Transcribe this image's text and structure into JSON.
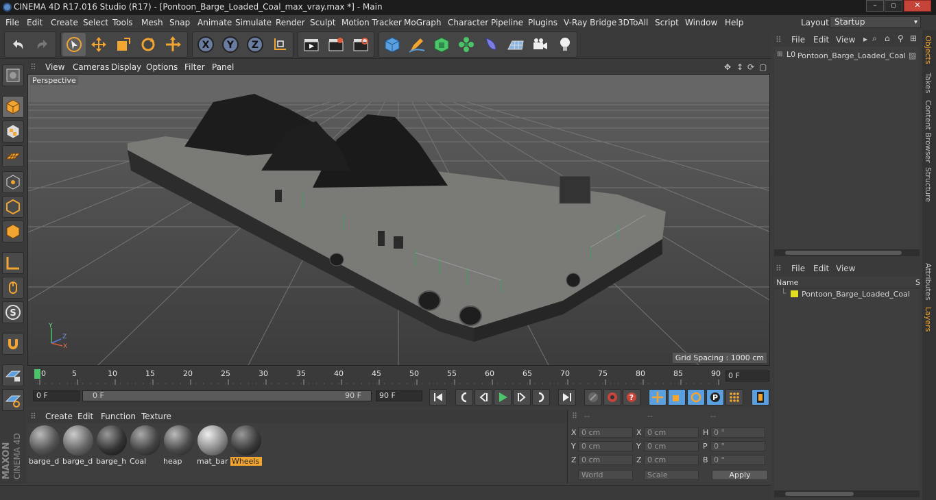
{
  "window": {
    "title": "CINEMA 4D R17.016 Studio (R17) - [Pontoon_Barge_Loaded_Coal_max_vray.max *] - Main",
    "minimize": "–",
    "maximize": "▫",
    "close": "✕"
  },
  "menu": [
    "File",
    "Edit",
    "Create",
    "Select",
    "Tools",
    "Mesh",
    "Snap",
    "Animate",
    "Simulate",
    "Render",
    "Sculpt",
    "Motion Tracker",
    "MoGraph",
    "Character",
    "Pipeline",
    "Plugins",
    "V-Ray Bridge",
    "3DToAll",
    "Script",
    "Window",
    "Help"
  ],
  "layout": {
    "label": "Layout:",
    "value": "Startup"
  },
  "viewport": {
    "menu": [
      "View",
      "Cameras",
      "Display",
      "Options",
      "Filter",
      "Panel"
    ],
    "label": "Perspective",
    "grid_spacing": "Grid Spacing : 1000 cm",
    "axis": {
      "x": "X",
      "y": "Y",
      "z": "Z"
    }
  },
  "timeline": {
    "ticks": [
      "0",
      "5",
      "10",
      "15",
      "20",
      "25",
      "30",
      "35",
      "40",
      "45",
      "50",
      "55",
      "60",
      "65",
      "70",
      "75",
      "80",
      "85",
      "90"
    ],
    "current_frame": "0 F"
  },
  "controls": {
    "start": "0 F",
    "range_start": "0 F",
    "range_end": "90 F",
    "end": "90 F"
  },
  "materials": {
    "menu": [
      "Create",
      "Edit",
      "Function",
      "Texture"
    ],
    "items": [
      {
        "name": "barge_d",
        "color": "#6a6a6a"
      },
      {
        "name": "barge_d",
        "color": "#777"
      },
      {
        "name": "barge_h",
        "color": "#3a3a3a"
      },
      {
        "name": "Coal",
        "color": "#555"
      },
      {
        "name": "heap",
        "color": "#5a5a5a"
      },
      {
        "name": "mat_bar",
        "color": "#8a8a8a"
      },
      {
        "name": "Wheels",
        "color": "#3f3f3f"
      }
    ]
  },
  "coords": {
    "headers": [
      "--",
      "--",
      "--"
    ],
    "rows": [
      [
        "X",
        "0 cm",
        "X",
        "0 cm",
        "H",
        "0 °"
      ],
      [
        "Y",
        "0 cm",
        "Y",
        "0 cm",
        "P",
        "0 °"
      ],
      [
        "Z",
        "0 cm",
        "Z",
        "0 cm",
        "B",
        "0 °"
      ]
    ],
    "world": "World",
    "scale": "Scale",
    "apply": "Apply"
  },
  "objects": {
    "menu": [
      "File",
      "Edit",
      "View"
    ],
    "item": "Pontoon_Barge_Loaded_Coal"
  },
  "layers": {
    "menu": [
      "File",
      "Edit",
      "View"
    ],
    "col_name": "Name",
    "col_s": "S",
    "item": "Pontoon_Barge_Loaded_Coal",
    "color": "#e0e020"
  },
  "side_tabs": [
    "Objects",
    "Takes",
    "Content Browser",
    "Structure",
    "Attributes",
    "Layers"
  ],
  "brand": {
    "maxon": "MAXON",
    "c4d": "CINEMA 4D"
  }
}
